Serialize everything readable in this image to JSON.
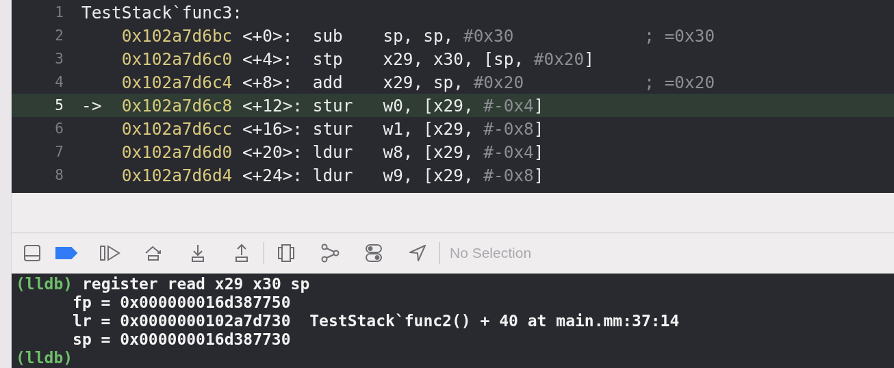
{
  "editor": {
    "lines": [
      {
        "number": "1",
        "kind": "label",
        "text": "TestStack`func3:",
        "current": false
      },
      {
        "number": "2",
        "kind": "instruction",
        "address": "0x102a7d6bc",
        "offset": "<+0>:",
        "mnemonic": "sub",
        "operands": [
          {
            "text": "sp, sp, ",
            "kind": "plain"
          },
          {
            "text": "#0x30",
            "kind": "immediate"
          }
        ],
        "comment": "; =0x30",
        "current": false
      },
      {
        "number": "3",
        "kind": "instruction",
        "address": "0x102a7d6c0",
        "offset": "<+4>:",
        "mnemonic": "stp",
        "operands": [
          {
            "text": "x29, x30, [sp, ",
            "kind": "plain"
          },
          {
            "text": "#0x20",
            "kind": "immediate"
          },
          {
            "text": "]",
            "kind": "plain"
          }
        ],
        "current": false
      },
      {
        "number": "4",
        "kind": "instruction",
        "address": "0x102a7d6c4",
        "offset": "<+8>:",
        "mnemonic": "add",
        "operands": [
          {
            "text": "x29, sp, ",
            "kind": "plain"
          },
          {
            "text": "#0x20",
            "kind": "immediate"
          }
        ],
        "comment": "; =0x20",
        "current": false
      },
      {
        "number": "5",
        "kind": "instruction",
        "marker": "->",
        "address": "0x102a7d6c8",
        "offset": "<+12>:",
        "mnemonic": "stur",
        "operands": [
          {
            "text": "w0, [x29, ",
            "kind": "plain"
          },
          {
            "text": "#-0x4",
            "kind": "immediate"
          },
          {
            "text": "]",
            "kind": "plain"
          }
        ],
        "current": true
      },
      {
        "number": "6",
        "kind": "instruction",
        "address": "0x102a7d6cc",
        "offset": "<+16>:",
        "mnemonic": "stur",
        "operands": [
          {
            "text": "w1, [x29, ",
            "kind": "plain"
          },
          {
            "text": "#-0x8",
            "kind": "immediate"
          },
          {
            "text": "]",
            "kind": "plain"
          }
        ],
        "current": false
      },
      {
        "number": "7",
        "kind": "instruction",
        "address": "0x102a7d6d0",
        "offset": "<+20>:",
        "mnemonic": "ldur",
        "operands": [
          {
            "text": "w8, [x29, ",
            "kind": "plain"
          },
          {
            "text": "#-0x4",
            "kind": "immediate"
          },
          {
            "text": "]",
            "kind": "plain"
          }
        ],
        "current": false
      },
      {
        "number": "8",
        "kind": "instruction",
        "address": "0x102a7d6d4",
        "offset": "<+24>:",
        "mnemonic": "ldur",
        "operands": [
          {
            "text": "w9, [x29, ",
            "kind": "plain"
          },
          {
            "text": "#-0x8",
            "kind": "immediate"
          },
          {
            "text": "]",
            "kind": "plain"
          }
        ],
        "current": false
      }
    ]
  },
  "debug_bar": {
    "buttons": [
      {
        "kind": "panel",
        "active": false
      },
      {
        "kind": "breakpoints",
        "active": true
      },
      {
        "kind": "continue",
        "active": false
      },
      {
        "kind": "step-over",
        "active": false
      },
      {
        "kind": "step-into",
        "active": false
      },
      {
        "kind": "step-out",
        "active": false
      },
      {
        "kind": "divider"
      },
      {
        "kind": "view-hierarchy",
        "active": false
      },
      {
        "kind": "memory-graph",
        "active": false
      },
      {
        "kind": "environment",
        "active": false
      },
      {
        "kind": "location",
        "active": false
      },
      {
        "kind": "divider"
      }
    ],
    "selection": "No Selection"
  },
  "console": {
    "lines": [
      {
        "kind": "command",
        "prompt": "(lldb)",
        "text": "register read x29 x30 sp"
      },
      {
        "kind": "output",
        "text": "fp = 0x000000016d387750"
      },
      {
        "kind": "output",
        "text": "lr = 0x0000000102a7d730  TestStack`func2() + 40 at main.mm:37:14"
      },
      {
        "kind": "output",
        "text": "sp = 0x000000016d387730"
      },
      {
        "kind": "prompt",
        "prompt": "(lldb)"
      }
    ]
  }
}
